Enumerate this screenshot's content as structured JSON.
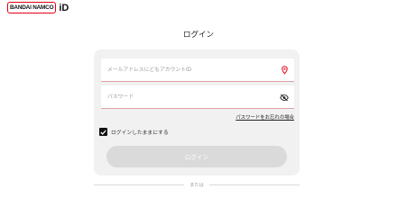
{
  "brand": {
    "logo_text": "BANDAI NAMCO",
    "id_text": "iD",
    "accent_color": "#e60012"
  },
  "page_title": "ログイン",
  "form": {
    "email": {
      "placeholder": "メールアドレスにどもアカウントID",
      "value": "",
      "icon": "required-marker-icon"
    },
    "password": {
      "placeholder": "パスワード",
      "value": "",
      "icon": "eye-slash-icon"
    },
    "forgot_password_link": "パスワードをお忘れの場合",
    "remember_me": {
      "label": "ログインしたままにする",
      "checked": true
    },
    "submit_label": "ログイン"
  },
  "divider_text": "または"
}
